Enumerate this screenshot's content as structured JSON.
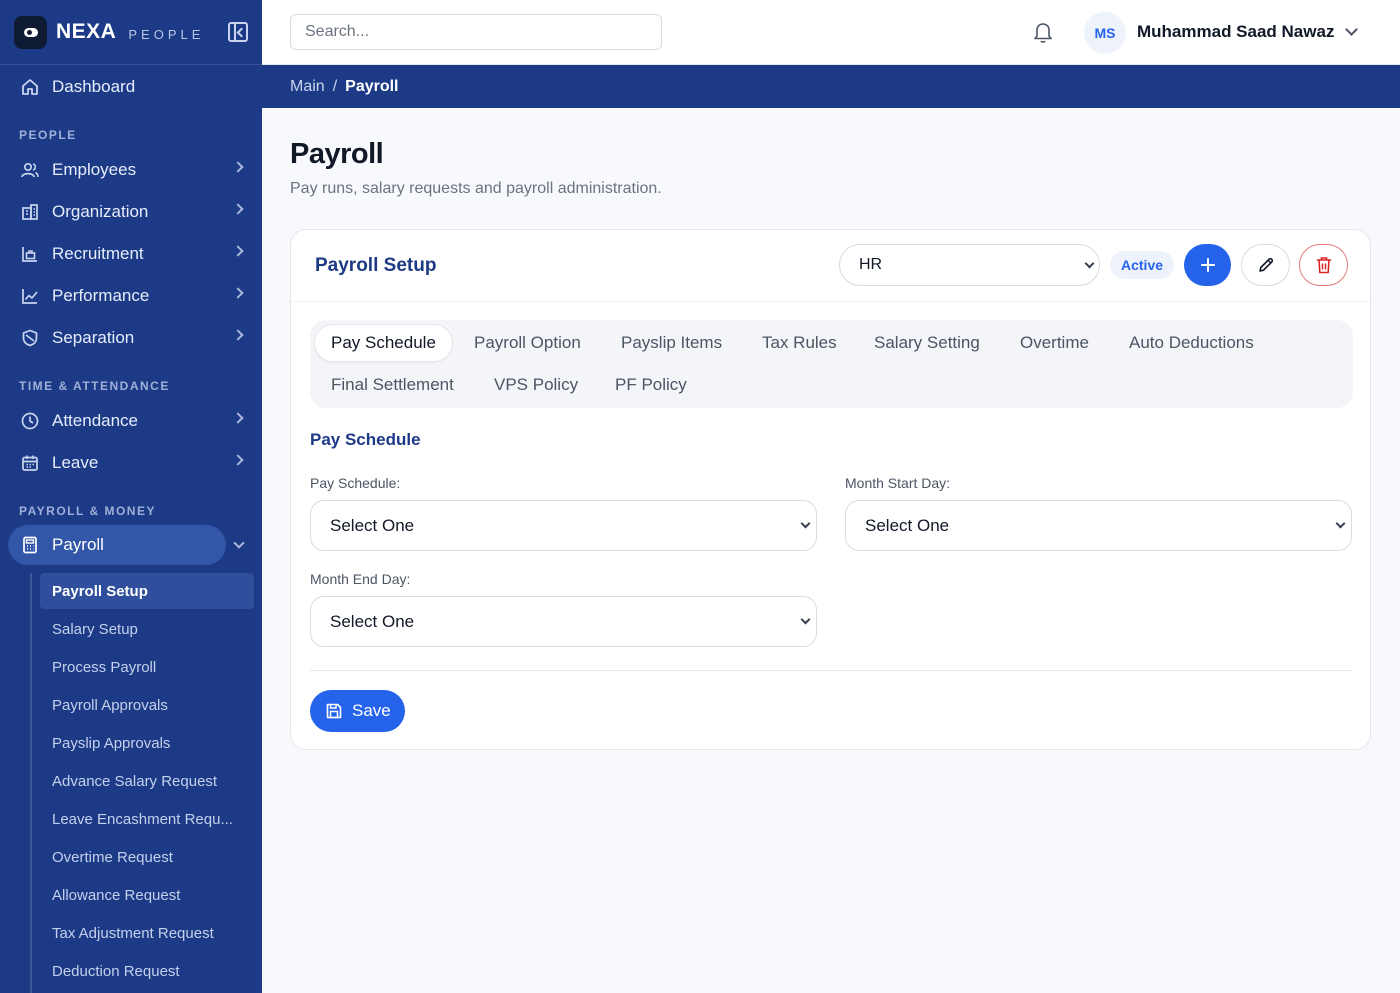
{
  "brand": {
    "name": "NEXA",
    "sub": "PEOPLE"
  },
  "search": {
    "placeholder": "Search..."
  },
  "user": {
    "initials": "MS",
    "name": "Muhammad Saad Nawaz"
  },
  "breadcrumb": {
    "root": "Main",
    "separator": "/",
    "current": "Payroll"
  },
  "sidebar": {
    "dashboard": "Dashboard",
    "sections": {
      "people": "PEOPLE",
      "time": "TIME & ATTENDANCE",
      "payroll": "PAYROLL & MONEY"
    },
    "people_items": [
      "Employees",
      "Organization",
      "Recruitment",
      "Performance",
      "Separation"
    ],
    "time_items": [
      "Attendance",
      "Leave"
    ],
    "payroll": "Payroll",
    "payroll_sub": [
      "Payroll Setup",
      "Salary Setup",
      "Process Payroll",
      "Payroll Approvals",
      "Payslip Approvals",
      "Advance Salary Request",
      "Leave Encashment Requ...",
      "Overtime Request",
      "Allowance Request",
      "Tax Adjustment Request",
      "Deduction Request"
    ]
  },
  "page": {
    "title": "Payroll",
    "subtitle": "Pay runs, salary requests and payroll administration."
  },
  "card": {
    "title": "Payroll Setup",
    "department_select": "HR",
    "status_badge": "Active"
  },
  "tabs": [
    "Pay Schedule",
    "Payroll Option",
    "Payslip Items",
    "Tax Rules",
    "Salary Setting",
    "Overtime",
    "Auto Deductions",
    "Final Settlement",
    "VPS Policy",
    "PF Policy"
  ],
  "form": {
    "section_title": "Pay Schedule",
    "pay_schedule_label": "Pay Schedule:",
    "pay_schedule_value": "Select One",
    "month_start_label": "Month Start Day:",
    "month_start_value": "Select One",
    "month_end_label": "Month End Day:",
    "month_end_value": "Select One",
    "save_label": "Save"
  },
  "colors": {
    "sidebar_bg": "#1c3a86",
    "primary": "#2563eb",
    "danger": "#dc2626"
  }
}
